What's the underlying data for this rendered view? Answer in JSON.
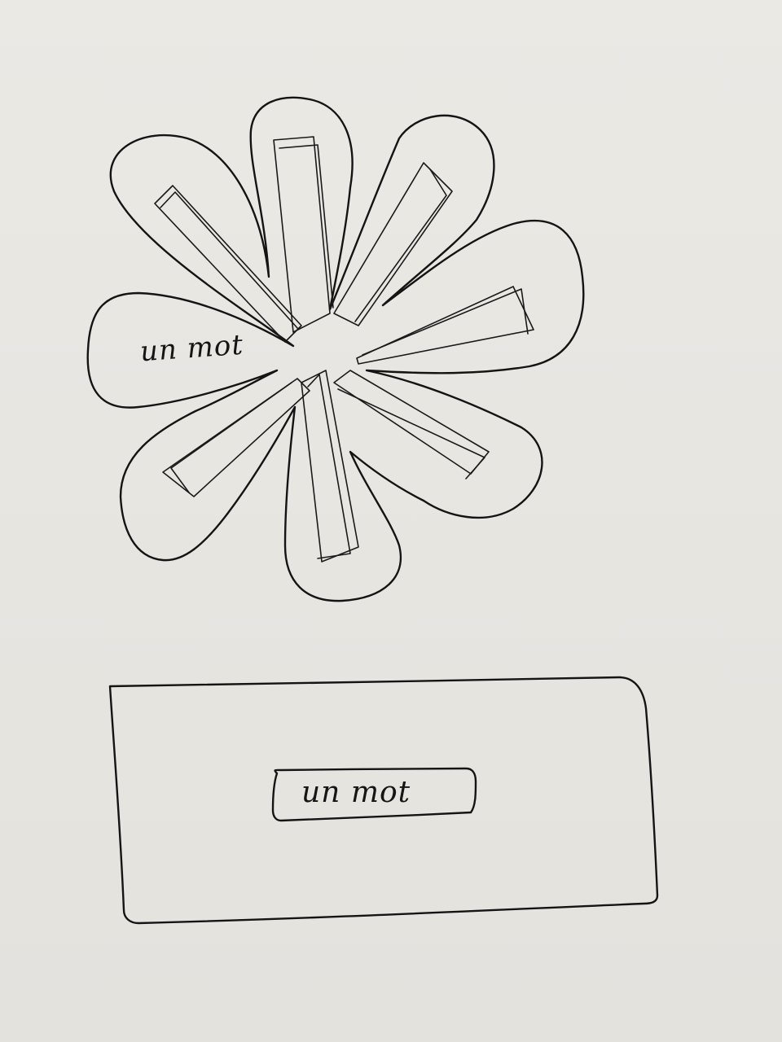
{
  "flower": {
    "petal_word": "un mot"
  },
  "card": {
    "tag_word": "un mot"
  }
}
